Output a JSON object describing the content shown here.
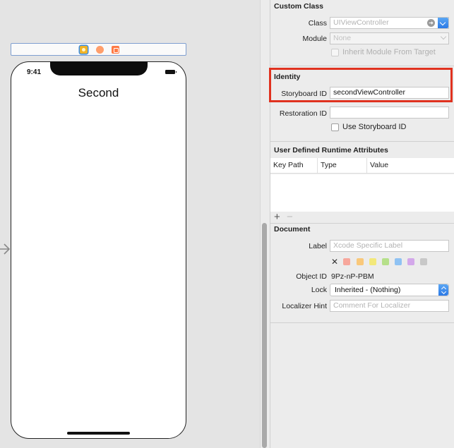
{
  "scene": {
    "dock_icons": [
      "view-controller-icon",
      "first-responder-icon",
      "exit-icon"
    ],
    "status_time": "9:41",
    "nav_title": "Second"
  },
  "custom_class": {
    "title": "Custom Class",
    "class_label": "Class",
    "class_placeholder": "UIViewController",
    "module_label": "Module",
    "module_placeholder": "None",
    "inherit_label": "Inherit Module From Target"
  },
  "identity": {
    "title": "Identity",
    "storyboard_id_label": "Storyboard ID",
    "storyboard_id_value": "secondViewController",
    "restoration_id_label": "Restoration ID",
    "restoration_id_value": "",
    "use_storyboard_id_label": "Use Storyboard ID",
    "highlight_color": "#e0321f"
  },
  "runtime_attributes": {
    "title": "User Defined Runtime Attributes",
    "columns": [
      "Key Path",
      "Type",
      "Value"
    ],
    "add_symbol": "+",
    "remove_symbol": "−"
  },
  "document": {
    "title": "Document",
    "label_label": "Label",
    "label_placeholder": "Xcode Specific Label",
    "clear_symbol": "✕",
    "swatch_colors": [
      "#f7a79c",
      "#f9c87a",
      "#f3e87a",
      "#b6e08a",
      "#8fc2f3",
      "#d3a8ea",
      "#c8c8c8"
    ],
    "object_id_label": "Object ID",
    "object_id_value": "9Pz-nP-PBM",
    "lock_label": "Lock",
    "lock_value": "Inherited - (Nothing)",
    "localizer_hint_label": "Localizer Hint",
    "localizer_hint_placeholder": "Comment For Localizer"
  }
}
